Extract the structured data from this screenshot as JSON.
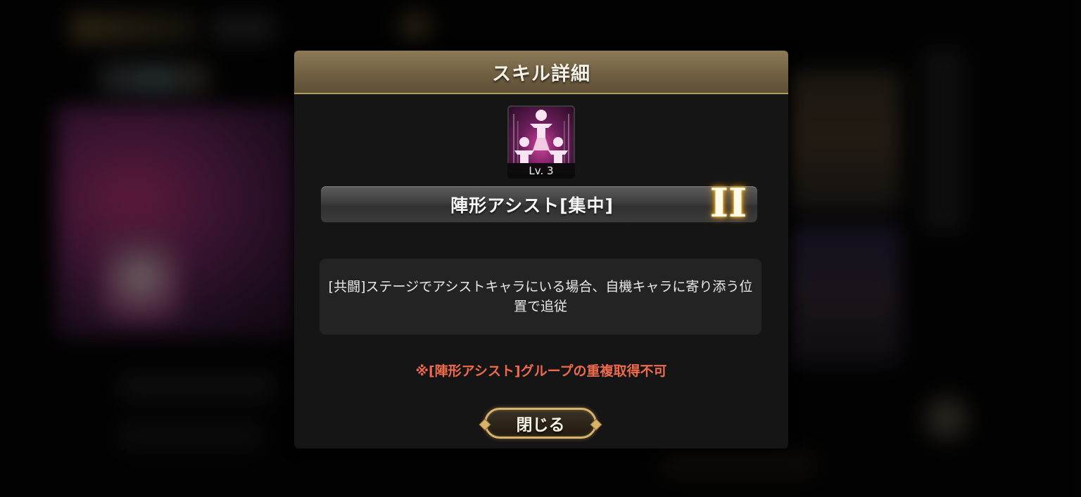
{
  "dialog": {
    "title": "スキル詳細",
    "skill": {
      "icon": "formation-assist-icon",
      "level": "Lv. 3",
      "name": "陣形アシスト[集中]",
      "rank": "II",
      "description": "[共闘]ステージでアシストキャラにいる場合、自機キャラに寄り添う位置で追従",
      "note": "※[陣形アシスト]グループの重複取得不可"
    },
    "close_label": "閉じる"
  },
  "colors": {
    "header": "#7a6a4a",
    "note": "#ef6a4c",
    "button_border": "#d9b36a",
    "icon_glow": "#d0409a"
  }
}
